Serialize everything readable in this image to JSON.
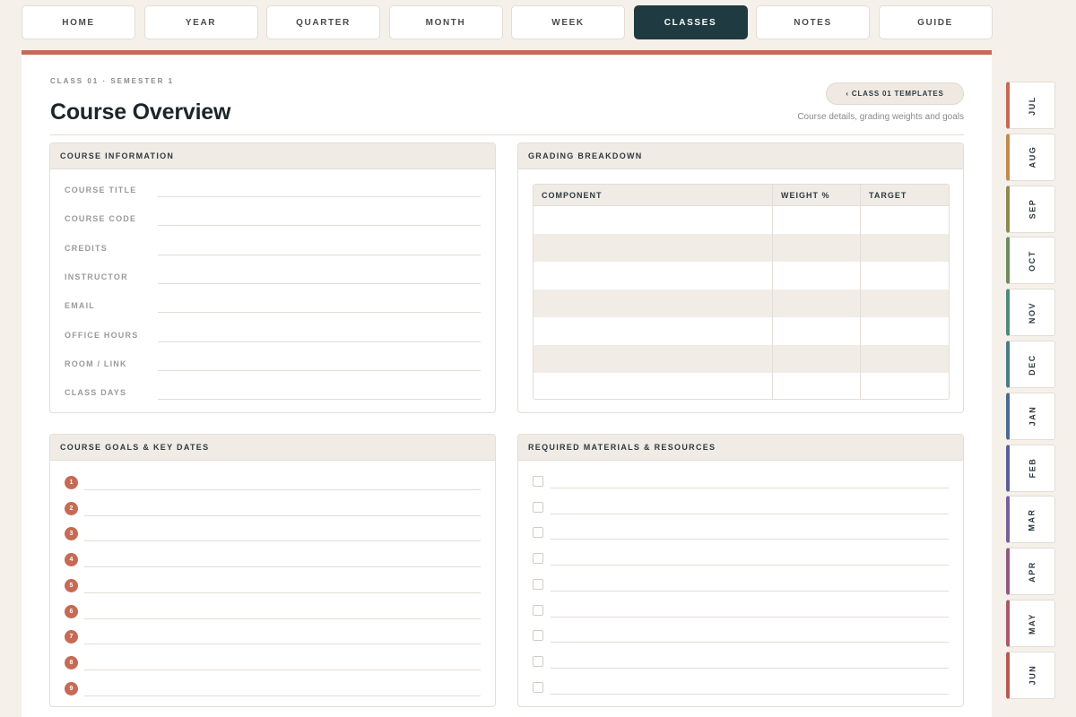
{
  "nav": {
    "items": [
      "HOME",
      "YEAR",
      "QUARTER",
      "MONTH",
      "WEEK",
      "CLASSES",
      "NOTES",
      "GUIDE"
    ],
    "active": "CLASSES"
  },
  "header": {
    "crumb": "CLASS 01 · SEMESTER 1",
    "title": "Course Overview",
    "templates_button": "‹ CLASS 01 TEMPLATES",
    "subtitle": "Course details, grading weights and goals"
  },
  "course_info": {
    "heading": "COURSE INFORMATION",
    "fields": [
      "COURSE TITLE",
      "COURSE CODE",
      "CREDITS",
      "INSTRUCTOR",
      "EMAIL",
      "OFFICE HOURS",
      "ROOM / LINK",
      "CLASS DAYS"
    ]
  },
  "grading": {
    "heading": "GRADING BREAKDOWN",
    "columns": [
      "COMPONENT",
      "WEIGHT %",
      "TARGET"
    ],
    "row_count": 7
  },
  "goals": {
    "heading": "COURSE GOALS & KEY DATES",
    "numbers": [
      "1",
      "2",
      "3",
      "4",
      "5",
      "6",
      "7",
      "8",
      "9"
    ]
  },
  "materials": {
    "heading": "REQUIRED MATERIALS & RESOURCES",
    "row_count": 9
  },
  "months": [
    {
      "label": "JUL",
      "color": "#c66a55"
    },
    {
      "label": "AUG",
      "color": "#c08a4e"
    },
    {
      "label": "SEP",
      "color": "#8c8a4e"
    },
    {
      "label": "OCT",
      "color": "#6e8a5e"
    },
    {
      "label": "NOV",
      "color": "#4e8a7a"
    },
    {
      "label": "DEC",
      "color": "#4a7a86"
    },
    {
      "label": "JAN",
      "color": "#4a6a92"
    },
    {
      "label": "FEB",
      "color": "#5a5e9a"
    },
    {
      "label": "MAR",
      "color": "#76609a"
    },
    {
      "label": "APR",
      "color": "#8e5a86"
    },
    {
      "label": "MAY",
      "color": "#a85a6a"
    },
    {
      "label": "JUN",
      "color": "#b85a50"
    }
  ],
  "colors": {
    "accent": "#c66a55",
    "active_nav": "#1f3a40",
    "panel_header": "#f0ebe5",
    "background": "#f5f0ea"
  }
}
